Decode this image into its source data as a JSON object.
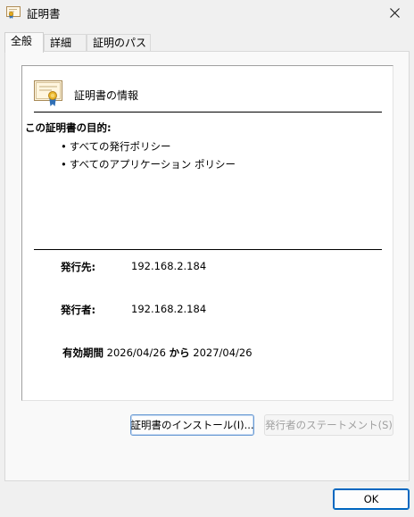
{
  "window": {
    "title": "証明書"
  },
  "tabs": [
    {
      "label": "全般"
    },
    {
      "label": "詳細"
    },
    {
      "label": "証明のパス"
    }
  ],
  "info": {
    "title": "証明書の情報",
    "purpose_heading": "この証明書の目的:",
    "purposes": [
      "すべての発行ポリシー",
      "すべてのアプリケーション ポリシー"
    ],
    "issued_to_label": "発行先:",
    "issued_to_value": "192.168.2.184",
    "issued_by_label": "発行者:",
    "issued_by_value": "192.168.2.184",
    "validity_label": "有効期間",
    "valid_from": "2026/04/26",
    "validity_connector": "から",
    "valid_to": "2027/04/26"
  },
  "buttons": {
    "install": "証明書のインストール(I)...",
    "issuer_statement": "発行者のステートメント(S)",
    "ok": "OK"
  },
  "colors": {
    "accent": "#0067c0",
    "ribbon": "#2f6fb5",
    "seal": "#e0a91e"
  },
  "icons": {
    "title": "certificate-icon",
    "info": "certificate-icon",
    "close": "close-icon"
  }
}
